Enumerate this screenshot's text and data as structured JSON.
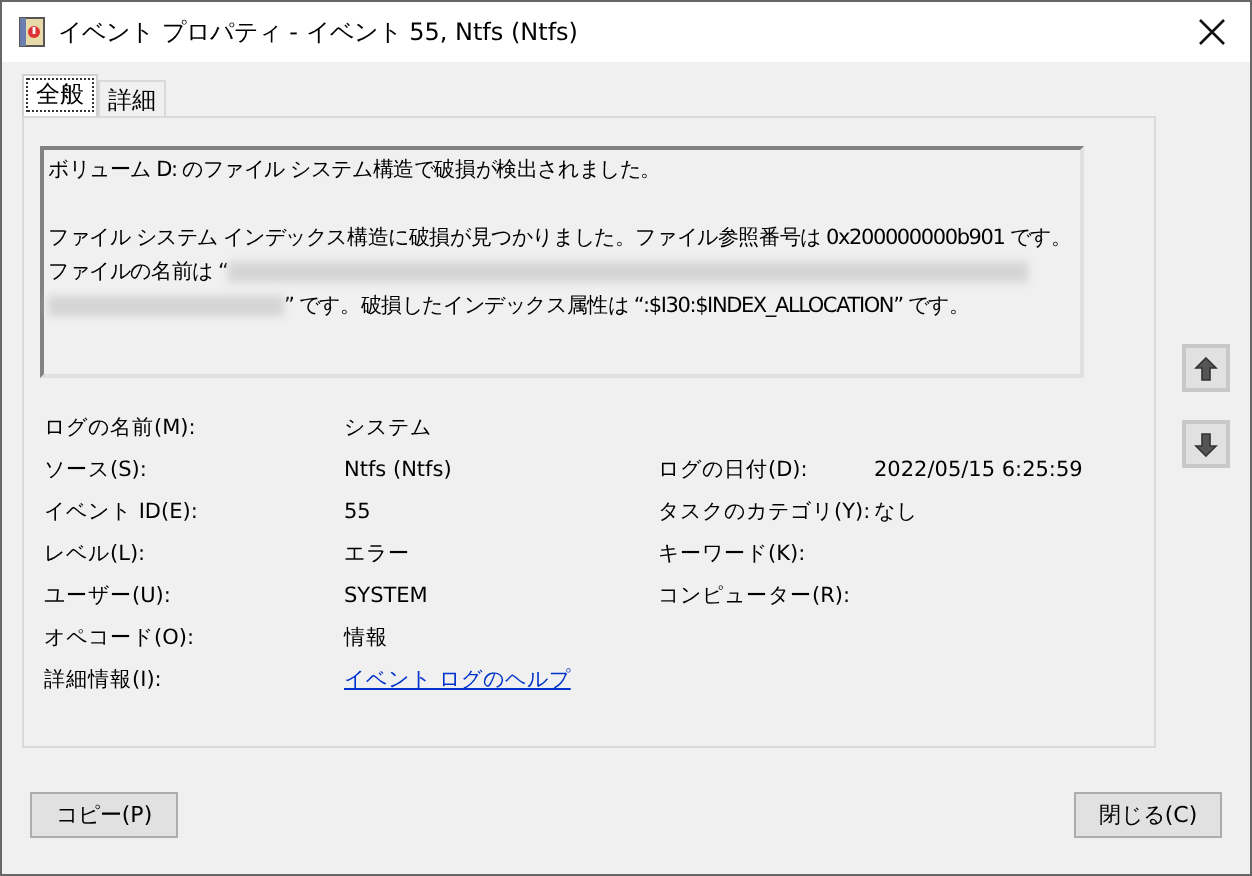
{
  "window": {
    "title": "イベント プロパティ - イベント 55, Ntfs (Ntfs)"
  },
  "tabs": [
    {
      "label": "全般",
      "selected": true
    },
    {
      "label": "詳細",
      "selected": false
    }
  ],
  "message": {
    "line_1": "ボリューム D: のファイル システム構造で破損が検出されました。",
    "line_2_before_redaction": "ファイル システム インデックス構造に破損が見つかりました。ファイル参照番号は 0x200000000b901 です。ファイルの名前は “",
    "line_2_after_redaction": "” です。破損したインデックス属性は “:$I30:$INDEX_ALLOCATION” です。"
  },
  "fields": [
    {
      "label": "ログの名前(M):",
      "value": "システム"
    },
    {
      "label": "ソース(S):",
      "value": "Ntfs (Ntfs)",
      "right_label": "ログの日付(D):",
      "right_value": "2022/05/15 6:25:59"
    },
    {
      "label": "イベント ID(E):",
      "value": "55",
      "right_label": "タスクのカテゴリ(Y):",
      "right_value": "なし"
    },
    {
      "label": "レベル(L):",
      "value": "エラー",
      "right_label": "キーワード(K):"
    },
    {
      "label": "ユーザー(U):",
      "value": "SYSTEM",
      "right_label": "コンピューター(R):"
    },
    {
      "label": "オペコード(O):",
      "value": "情報"
    },
    {
      "label": "詳細情報(I):",
      "value": "イベント ログのヘルプ",
      "kind": "link"
    }
  ],
  "buttons": {
    "copy": "コピー(P)",
    "close": "閉じる(C)"
  }
}
